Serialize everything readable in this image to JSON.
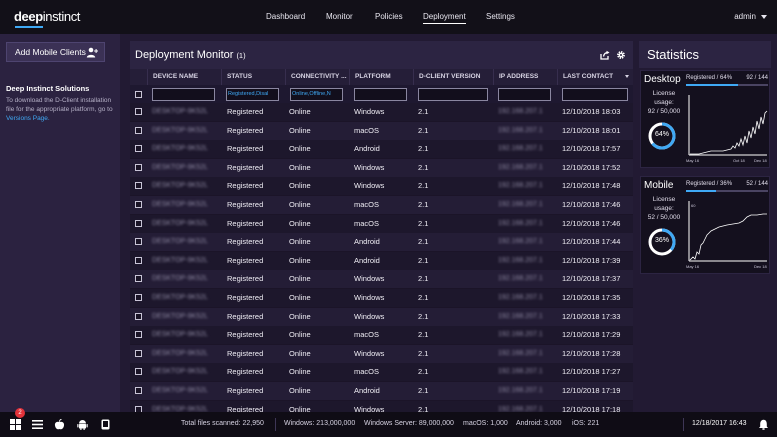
{
  "app": {
    "logo_part1": "deep",
    "logo_part2": "instinct",
    "accent_color": "#3fa9f5"
  },
  "nav": {
    "items": [
      "Dashboard",
      "Monitor",
      "Policies",
      "Deployment",
      "Settings"
    ],
    "active": "Deployment",
    "user": "admin"
  },
  "sidebar": {
    "add_button": "Add Mobile Clients",
    "add_icon": "add-user-icon",
    "solutions_title": "Deep Instinct Solutions",
    "solutions_text": "To download the D-Client installation file for the appropriate platform, go to",
    "solutions_link": "Versions Page."
  },
  "monitor": {
    "title": "Deployment Monitor",
    "count": "(1)",
    "columns": [
      "DEVICE NAME",
      "STATUS",
      "CONNECTIVITY ...",
      "PLATFORM",
      "D-CLIENT VERSION",
      "IP ADDRESS",
      "LAST CONTACT"
    ],
    "filters": {
      "status": "Registered,Disal",
      "connectivity": "Online,Offline,N"
    },
    "rows": [
      {
        "device": "DESKTOP-9K52L",
        "status": "Registered",
        "connectivity": "Online",
        "platform": "Windows",
        "version": "2.1",
        "ip": "192.168.207.1",
        "last_contact": "12/10/2018 18:03"
      },
      {
        "device": "DESKTOP-9K52L",
        "status": "Registered",
        "connectivity": "Online",
        "platform": "macOS",
        "version": "2.1",
        "ip": "192.168.207.1",
        "last_contact": "12/10/2018 18:01"
      },
      {
        "device": "DESKTOP-9K52L",
        "status": "Registered",
        "connectivity": "Online",
        "platform": "Android",
        "version": "2.1",
        "ip": "192.168.207.1",
        "last_contact": "12/10/2018 17:57"
      },
      {
        "device": "DESKTOP-9K52L",
        "status": "Registered",
        "connectivity": "Online",
        "platform": "Windows",
        "version": "2.1",
        "ip": "192.168.207.1",
        "last_contact": "12/10/2018 17:52"
      },
      {
        "device": "DESKTOP-9K52L",
        "status": "Registered",
        "connectivity": "Online",
        "platform": "Windows",
        "version": "2.1",
        "ip": "192.168.207.1",
        "last_contact": "12/10/2018 17:48"
      },
      {
        "device": "DESKTOP-9K52L",
        "status": "Registered",
        "connectivity": "Online",
        "platform": "macOS",
        "version": "2.1",
        "ip": "192.168.207.1",
        "last_contact": "12/10/2018 17:46"
      },
      {
        "device": "DESKTOP-9K52L",
        "status": "Registered",
        "connectivity": "Online",
        "platform": "macOS",
        "version": "2.1",
        "ip": "192.168.207.1",
        "last_contact": "12/10/2018 17:46"
      },
      {
        "device": "DESKTOP-9K52L",
        "status": "Registered",
        "connectivity": "Online",
        "platform": "Android",
        "version": "2.1",
        "ip": "192.168.207.1",
        "last_contact": "12/10/2018 17:44"
      },
      {
        "device": "DESKTOP-9K52L",
        "status": "Registered",
        "connectivity": "Online",
        "platform": "Android",
        "version": "2.1",
        "ip": "192.168.207.1",
        "last_contact": "12/10/2018 17:39"
      },
      {
        "device": "DESKTOP-9K52L",
        "status": "Registered",
        "connectivity": "Online",
        "platform": "Windows",
        "version": "2.1",
        "ip": "192.168.207.1",
        "last_contact": "12/10/2018 17:37"
      },
      {
        "device": "DESKTOP-9K52L",
        "status": "Registered",
        "connectivity": "Online",
        "platform": "Windows",
        "version": "2.1",
        "ip": "192.168.207.1",
        "last_contact": "12/10/2018 17:35"
      },
      {
        "device": "DESKTOP-9K52L",
        "status": "Registered",
        "connectivity": "Online",
        "platform": "Windows",
        "version": "2.1",
        "ip": "192.168.207.1",
        "last_contact": "12/10/2018 17:33"
      },
      {
        "device": "DESKTOP-9K52L",
        "status": "Registered",
        "connectivity": "Online",
        "platform": "macOS",
        "version": "2.1",
        "ip": "192.168.207.1",
        "last_contact": "12/10/2018 17:29"
      },
      {
        "device": "DESKTOP-9K52L",
        "status": "Registered",
        "connectivity": "Online",
        "platform": "Windows",
        "version": "2.1",
        "ip": "192.168.207.1",
        "last_contact": "12/10/2018 17:28"
      },
      {
        "device": "DESKTOP-9K52L",
        "status": "Registered",
        "connectivity": "Online",
        "platform": "macOS",
        "version": "2.1",
        "ip": "192.168.207.1",
        "last_contact": "12/10/2018 17:27"
      },
      {
        "device": "DESKTOP-9K52L",
        "status": "Registered",
        "connectivity": "Online",
        "platform": "Android",
        "version": "2.1",
        "ip": "192.168.207.1",
        "last_contact": "12/10/2018 17:19"
      },
      {
        "device": "DESKTOP-9K52L",
        "status": "Registered",
        "connectivity": "Online",
        "platform": "Windows",
        "version": "2.1",
        "ip": "192.168.207.1",
        "last_contact": "12/10/2018 17:18"
      }
    ]
  },
  "statistics": {
    "title": "Statistics",
    "cards": [
      {
        "name": "Desktop",
        "license_label": "License usage:",
        "license_value": "92 / 50,000",
        "bar_label": "Registered / 64%",
        "bar_value": "92 / 144",
        "percent": 64,
        "percent_label": "64%",
        "axis_max": "",
        "axis_start": "May 16",
        "axis_mid": "Oct 18",
        "axis_end": "Dec 18"
      },
      {
        "name": "Mobile",
        "license_label": "License usage:",
        "license_value": "52 / 50,000",
        "bar_label": "Registered / 36%",
        "bar_value": "52 / 144",
        "percent": 36,
        "percent_label": "36%",
        "axis_max": "60",
        "axis_start": "May 16",
        "axis_mid": "",
        "axis_end": "Dec 18"
      }
    ]
  },
  "statusbar": {
    "badge_count": "2",
    "icons": [
      "windows-icon",
      "list-icon",
      "apple-icon",
      "android-icon",
      "mobile-icon"
    ],
    "total_label": "Total files scanned: 22,950",
    "windows": "Windows: 213,000,000",
    "windows_server": "Windows Server: 89,000,000",
    "macos": "macOS: 1,000",
    "android": "Android: 3,000",
    "ios": "iOS: 221",
    "datetime": "12/18/2017 16:43"
  }
}
